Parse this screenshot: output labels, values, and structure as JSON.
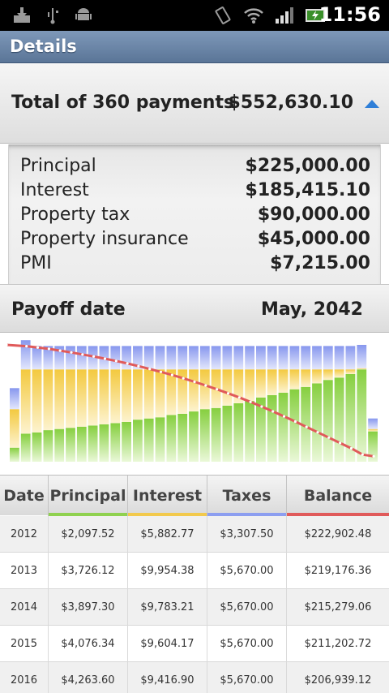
{
  "status_bar": {
    "time": "11:56",
    "icons": [
      "download-icon",
      "usb-icon",
      "android-icon",
      "vibrate-icon",
      "wifi-icon",
      "signal-icon",
      "battery-icon"
    ]
  },
  "title": "Details",
  "total": {
    "label": "Total of 360 payments",
    "value": "$552,630.10",
    "arrow": "collapse-arrow-icon"
  },
  "breakdown": [
    {
      "label": "Principal",
      "value": "$225,000.00"
    },
    {
      "label": "Interest",
      "value": "$185,415.10"
    },
    {
      "label": "Property tax",
      "value": "$90,000.00"
    },
    {
      "label": "Property insurance",
      "value": "$45,000.00"
    },
    {
      "label": "PMI",
      "value": "$7,215.00"
    }
  ],
  "payoff": {
    "label": "Payoff date",
    "value": "May, 2042"
  },
  "colors": {
    "principal": "#8fd14f",
    "interest": "#f2c94c",
    "taxes": "#8c9ef0",
    "balance": "#e05a5a",
    "accent": "#2f7fd8"
  },
  "chart_data": {
    "type": "bar",
    "stacked": true,
    "series": [
      {
        "name": "Principal",
        "values": [
          0.12,
          0.24,
          0.25,
          0.27,
          0.28,
          0.29,
          0.3,
          0.31,
          0.32,
          0.33,
          0.34,
          0.36,
          0.37,
          0.38,
          0.4,
          0.41,
          0.43,
          0.45,
          0.46,
          0.48,
          0.5,
          0.52,
          0.55,
          0.57,
          0.59,
          0.62,
          0.64,
          0.67,
          0.7,
          0.72,
          0.75,
          0.79,
          0.26
        ]
      },
      {
        "name": "Interest",
        "values": [
          0.33,
          0.55,
          0.54,
          0.52,
          0.51,
          0.5,
          0.49,
          0.48,
          0.47,
          0.46,
          0.45,
          0.43,
          0.42,
          0.41,
          0.39,
          0.38,
          0.36,
          0.34,
          0.33,
          0.31,
          0.29,
          0.27,
          0.24,
          0.22,
          0.2,
          0.17,
          0.15,
          0.12,
          0.09,
          0.07,
          0.04,
          0.01,
          0.02
        ]
      },
      {
        "name": "Taxes",
        "values": [
          0.18,
          0.25,
          0.2,
          0.2,
          0.2,
          0.2,
          0.2,
          0.2,
          0.2,
          0.2,
          0.2,
          0.2,
          0.2,
          0.2,
          0.2,
          0.2,
          0.2,
          0.2,
          0.2,
          0.2,
          0.2,
          0.2,
          0.2,
          0.2,
          0.2,
          0.2,
          0.2,
          0.2,
          0.2,
          0.2,
          0.2,
          0.2,
          0.09
        ]
      },
      {
        "name": "Balance",
        "values": [
          1.0,
          0.985,
          0.97,
          0.955,
          0.935,
          0.915,
          0.893,
          0.87,
          0.845,
          0.82,
          0.792,
          0.762,
          0.73,
          0.697,
          0.662,
          0.625,
          0.586,
          0.545,
          0.502,
          0.457,
          0.41,
          0.36,
          0.308,
          0.254,
          0.198,
          0.14,
          0.08,
          0.02,
          -0.04,
          -0.1,
          -0.16,
          -0.23,
          -0.25
        ]
      }
    ]
  },
  "table": {
    "headers": [
      "Date",
      "Principal",
      "Interest",
      "Taxes",
      "Balance"
    ],
    "rows": [
      [
        "2012",
        "$2,097.52",
        "$5,882.77",
        "$3,307.50",
        "$222,902.48"
      ],
      [
        "2013",
        "$3,726.12",
        "$9,954.38",
        "$5,670.00",
        "$219,176.36"
      ],
      [
        "2014",
        "$3,897.30",
        "$9,783.21",
        "$5,670.00",
        "$215,279.06"
      ],
      [
        "2015",
        "$4,076.34",
        "$9,604.17",
        "$5,670.00",
        "$211,202.72"
      ],
      [
        "2016",
        "$4,263.60",
        "$9,416.90",
        "$5,670.00",
        "$206,939.12"
      ]
    ]
  }
}
